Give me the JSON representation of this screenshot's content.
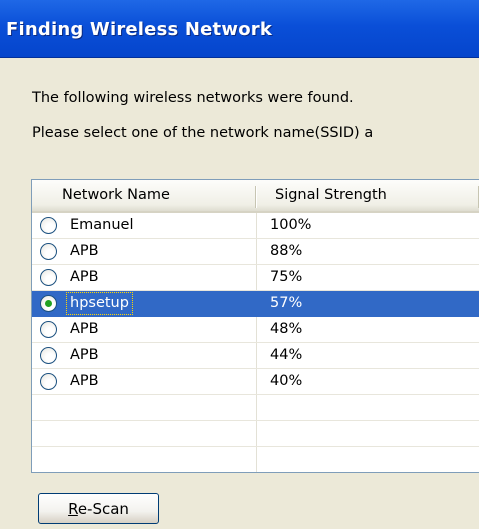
{
  "window": {
    "title": "Finding Wireless Network"
  },
  "messages": {
    "found": "The following wireless networks were found.",
    "instruction": "Please select one of the network name(SSID) a"
  },
  "table": {
    "columns": [
      "Network Name",
      "Signal Strength"
    ],
    "rows": [
      {
        "name": "Emanuel",
        "signal": "100%",
        "selected": false
      },
      {
        "name": "APB",
        "signal": "88%",
        "selected": false
      },
      {
        "name": "APB",
        "signal": "75%",
        "selected": false
      },
      {
        "name": "hpsetup",
        "signal": "57%",
        "selected": true
      },
      {
        "name": "APB",
        "signal": "48%",
        "selected": false
      },
      {
        "name": "APB",
        "signal": "44%",
        "selected": false
      },
      {
        "name": "APB",
        "signal": "40%",
        "selected": false
      }
    ]
  },
  "buttons": {
    "rescan_mnemonic": "R",
    "rescan_rest": "e-Scan"
  },
  "colors": {
    "titlebar": "#0a4fd8",
    "selection": "#3169c6",
    "dialog": "#ece9d8"
  }
}
